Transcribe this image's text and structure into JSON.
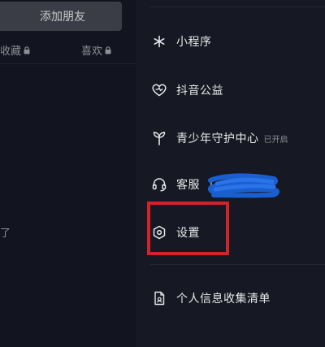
{
  "left_pane": {
    "add_friend_label": "添加朋友",
    "tabs": [
      {
        "label": "收藏"
      },
      {
        "label": "喜欢"
      }
    ],
    "empty_text": "了"
  },
  "menu": {
    "items": [
      {
        "label": "小程序",
        "icon": "mini-program-icon"
      },
      {
        "label": "抖音公益",
        "icon": "charity-heart-icon"
      },
      {
        "label": "青少年守护中心",
        "icon": "sprout-icon",
        "badge": "已开启"
      },
      {
        "label": "客服",
        "icon": "headset-icon",
        "suffix": "("
      },
      {
        "label": "设置",
        "icon": "settings-icon"
      },
      {
        "label": "个人信息收集清单",
        "icon": "document-icon"
      }
    ]
  },
  "colors": {
    "background": "#161823",
    "text": "#e8e8ea",
    "highlight_box": "#d4222a",
    "scribble": "#1a5fd0"
  }
}
